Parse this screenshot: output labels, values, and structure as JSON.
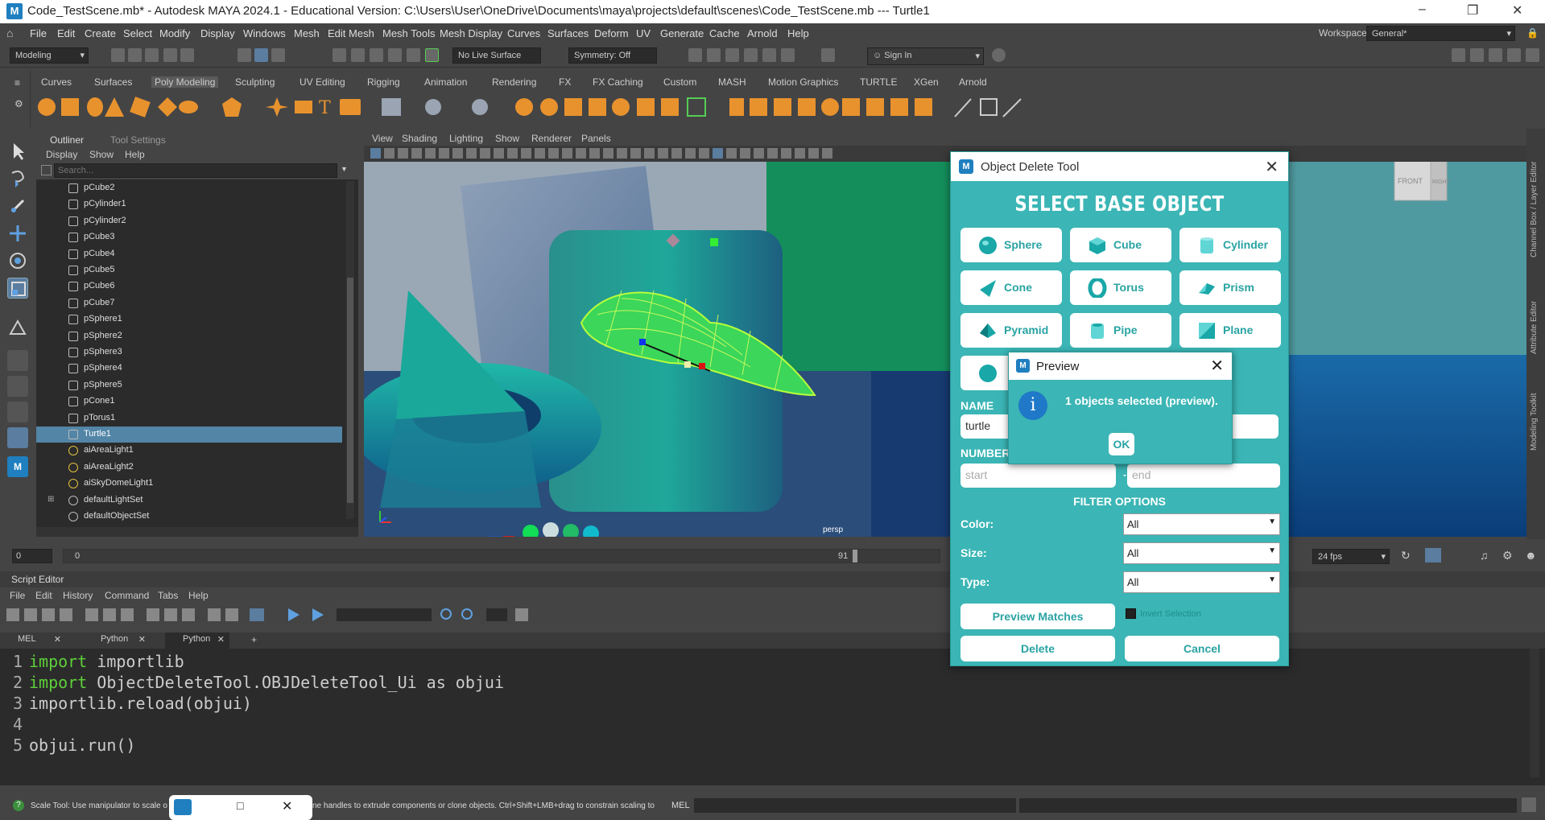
{
  "titlebar": {
    "text": "Code_TestScene.mb* - Autodesk MAYA 2024.1 - Educational Version: C:\\Users\\User\\OneDrive\\Documents\\maya\\projects\\default\\scenes\\Code_TestScene.mb   ---   Turtle1",
    "logo": "M"
  },
  "menubar": {
    "items": [
      "File",
      "Edit",
      "Create",
      "Select",
      "Modify",
      "Display",
      "Windows",
      "Mesh",
      "Edit Mesh",
      "Mesh Tools",
      "Mesh Display",
      "Curves",
      "Surfaces",
      "Deform",
      "UV",
      "Generate",
      "Cache",
      "Arnold",
      "Help"
    ],
    "workspace_label": "Workspace:",
    "workspace_value": "General*"
  },
  "toolbar": {
    "mode": "Modeling",
    "live_surface": "No Live Surface",
    "symmetry": "Symmetry: Off",
    "sign_in": "Sign In"
  },
  "shelf": {
    "tabs": [
      "Curves",
      "Surfaces",
      "Poly Modeling",
      "Sculpting",
      "UV Editing",
      "Rigging",
      "Animation",
      "Rendering",
      "FX",
      "FX Caching",
      "Custom",
      "MASH",
      "Motion Graphics",
      "TURTLE",
      "XGen",
      "Arnold"
    ],
    "active_tab": "Poly Modeling",
    "accent": "#e8922e"
  },
  "outliner": {
    "tabs": [
      "Outliner",
      "Tool Settings"
    ],
    "menu": [
      "Display",
      "Show",
      "Help"
    ],
    "search_placeholder": "Search...",
    "items": [
      "pCube2",
      "pCylinder1",
      "pCylinder2",
      "pCube3",
      "pCube4",
      "pCube5",
      "pCube6",
      "pCube7",
      "pSphere1",
      "pSphere2",
      "pSphere3",
      "pSphere4",
      "pSphere5",
      "pCone1",
      "pTorus1",
      "Turtle1",
      "aiAreaLight1",
      "aiAreaLight2",
      "aiSkyDomeLight1",
      "defaultLightSet",
      "defaultObjectSet"
    ],
    "selected": "Turtle1"
  },
  "viewport": {
    "menu": [
      "View",
      "Shading",
      "Lighting",
      "Show",
      "Renderer",
      "Panels"
    ],
    "camera_label": "persp",
    "viewcube_front": "FRONT",
    "viewcube_right": "RIGHT"
  },
  "right_panel": {
    "labels": [
      "Channel Box / Layer Editor",
      "Attribute Editor",
      "Modeling Toolkit"
    ]
  },
  "timeline": {
    "start": "0",
    "current": "0",
    "end_marker": "91",
    "fps": "24 fps"
  },
  "script_editor": {
    "title": "Script Editor",
    "menu": [
      "File",
      "Edit",
      "History",
      "Command",
      "Tabs",
      "Help"
    ],
    "tabs": [
      "MEL",
      "Python",
      "Python"
    ],
    "active_tab_index": 2,
    "code_lines": [
      {
        "num": "1",
        "kw": "import",
        "rest": " importlib"
      },
      {
        "num": "2",
        "kw": "import",
        "rest": " ObjectDeleteTool.OBJDeleteTool_Ui as objui"
      },
      {
        "num": "3",
        "kw": "",
        "rest": "importlib.reload(objui)"
      },
      {
        "num": "4",
        "kw": "",
        "rest": ""
      },
      {
        "num": "5",
        "kw": "",
        "rest": "objui.run()"
      }
    ]
  },
  "statusbar": {
    "left_text": "Scale Tool: Use manipulator to scale o",
    "right_text": "ne handles to extrude components or clone objects. Ctrl+Shift+LMB+drag to constrain scaling to",
    "lang": "MEL"
  },
  "dialog": {
    "title": "Object Delete Tool",
    "heading": "SELECT BASE OBJECT",
    "buttons": [
      "Sphere",
      "Cube",
      "Cylinder",
      "Cone",
      "Torus",
      "Prism",
      "Pyramid",
      "Pipe",
      "Plane"
    ],
    "name_label": "NAME",
    "name_value": "turtle",
    "number_label": "NUMBER",
    "start_placeholder": "start",
    "end_placeholder": "end",
    "range_sep": "-",
    "filter_heading": "FILTER OPTIONS",
    "color_label": "Color:",
    "color_value": "All",
    "size_label": "Size:",
    "size_value": "All",
    "type_label": "Type:",
    "type_value": "All",
    "preview_button": "Preview Matches",
    "invert_label": "Invert Selection",
    "delete_button": "Delete",
    "cancel_button": "Cancel",
    "bg": "#3bb5b5"
  },
  "preview": {
    "title": "Preview",
    "message": "1 objects selected (preview).",
    "ok": "OK",
    "icon": "i"
  }
}
